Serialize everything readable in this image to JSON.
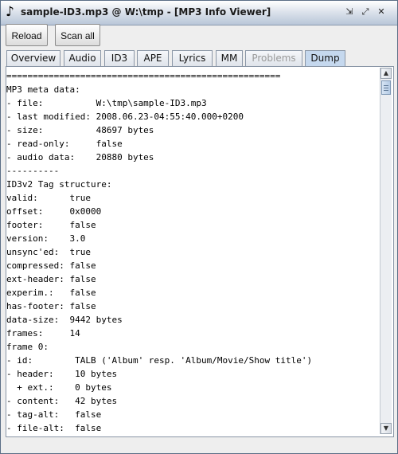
{
  "window": {
    "title": "sample-ID3.mp3 @ W:\\tmp - [MP3 Info Viewer]",
    "icon": "music-note-icon",
    "icon_glyph": "♪",
    "controls": {
      "minimize": "⇲",
      "maximize": "⤢",
      "close": "✕"
    }
  },
  "toolbar": {
    "reload_label": "Reload",
    "scan_label": "Scan all"
  },
  "tabs": [
    {
      "label": "Overview",
      "state": "normal"
    },
    {
      "label": "Audio",
      "state": "normal"
    },
    {
      "label": "ID3",
      "state": "normal"
    },
    {
      "label": "APE",
      "state": "normal"
    },
    {
      "label": "Lyrics",
      "state": "normal"
    },
    {
      "label": "MM",
      "state": "normal"
    },
    {
      "label": "Problems",
      "state": "disabled"
    },
    {
      "label": "Dump",
      "state": "active"
    }
  ],
  "dump_lines": [
    "====================================================",
    "MP3 meta data:",
    "- file:          W:\\tmp\\sample-ID3.mp3",
    "- last modified: 2008.06.23-04:55:40.000+0200",
    "- size:          48697 bytes",
    "- read-only:     false",
    "- audio data:    20880 bytes",
    "----------",
    "ID3v2 Tag structure:",
    "valid:      true",
    "offset:     0x0000",
    "footer:     false",
    "version:    3.0",
    "unsync'ed:  true",
    "compressed: false",
    "ext-header: false",
    "experim.:   false",
    "has-footer: false",
    "data-size:  9442 bytes",
    "frames:     14",
    "frame 0:",
    "- id:        TALB ('Album' resp. 'Album/Movie/Show title')",
    "- header:    10 bytes",
    "  + ext.:    0 bytes",
    "- content:   42 bytes",
    "- tag-alt:   false",
    "- file-alt:  false"
  ],
  "scrollbar": {
    "position": 0.0
  },
  "colors": {
    "active_tab": "#c5d8ee",
    "titlebar": "#dde3ec"
  }
}
